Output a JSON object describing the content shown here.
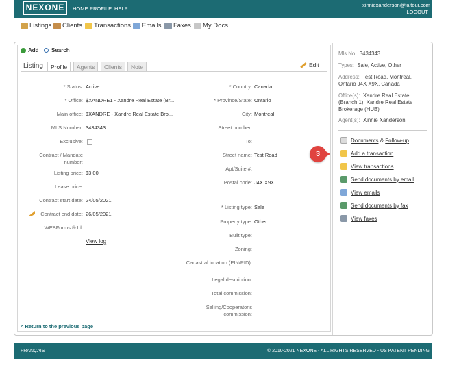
{
  "header": {
    "logo": "NEXONE",
    "nav": [
      "HOME",
      "PROFILE",
      "HELP"
    ],
    "user_email": "xinniexanderson@faltour.com",
    "logout": "LOGOUT"
  },
  "subnav": {
    "items": [
      {
        "label": "Listings",
        "icon": "house-icon"
      },
      {
        "label": "Clients",
        "icon": "people-icon"
      },
      {
        "label": "Transactions",
        "icon": "folder-icon"
      },
      {
        "label": "Emails",
        "icon": "envelope-icon"
      },
      {
        "label": "Faxes",
        "icon": "fax-icon"
      },
      {
        "label": "My Docs",
        "icon": "docs-icon"
      }
    ]
  },
  "toolbar": {
    "add": "Add",
    "search": "Search"
  },
  "tabs": {
    "title": "Listing",
    "items": [
      "Profile",
      "Agents",
      "Clients",
      "Note"
    ],
    "edit": "Edit"
  },
  "left_fields": [
    {
      "label": "* Status:",
      "value": "Active"
    },
    {
      "label": "* Office:",
      "value": "$XANDRE1 - Xandre Real Estate (Br..."
    },
    {
      "label": "Main office:",
      "value": "$XANDRE - Xandre Real Estate Bro..."
    },
    {
      "label": "MLS Number:",
      "value": "3434343"
    },
    {
      "label": "Exclusive:",
      "value": ""
    },
    {
      "label": "Contract / Mandate number:",
      "value": ""
    },
    {
      "label": "Listing price:",
      "value": "$3.00"
    },
    {
      "label": "Lease price:",
      "value": ""
    },
    {
      "label": "Contract start date:",
      "value": "24/05/2021"
    },
    {
      "label": "Contract end date:",
      "value": "26/05/2021"
    },
    {
      "label": "WEBForms ® Id:",
      "value": ""
    }
  ],
  "view_log": "View log",
  "right_fields": [
    {
      "label": "* Country:",
      "value": "Canada"
    },
    {
      "label": "* Province/State:",
      "value": "Ontario"
    },
    {
      "label": "City:",
      "value": "Montreal"
    },
    {
      "label": "Street number:",
      "value": ""
    },
    {
      "label": "To:",
      "value": ""
    },
    {
      "label": "Street name:",
      "value": "Test Road"
    },
    {
      "label": "Apt/Suite #:",
      "value": ""
    },
    {
      "label": "Postal code:",
      "value": "J4X X9X"
    },
    {
      "label": "* Listing type:",
      "value": "Sale"
    },
    {
      "label": "Property type:",
      "value": "Other"
    },
    {
      "label": "Built type:",
      "value": ""
    },
    {
      "label": "Zoning:",
      "value": ""
    },
    {
      "label": "Cadastral location (PIN/PID):",
      "value": ""
    },
    {
      "label": "Legal description:",
      "value": ""
    },
    {
      "label": "Total commission:",
      "value": ""
    },
    {
      "label": "Selling/Cooperator's commission:",
      "value": ""
    }
  ],
  "return_link": "< Return to the previous page",
  "summary": {
    "mls_label": "Mls No.",
    "mls_value": "3434343",
    "types_label": "Types:",
    "types_value": "Sale, Active, Other",
    "address_label": "Address:",
    "address_value": "Test Road, Montreal, Ontario J4X X9X, Canada",
    "offices_label": "Office(s):",
    "offices_value": "Xandre Real Estate (Branch 1), Xandre Real Estate Brokerage (HUB)",
    "agents_label": "Agent(s):",
    "agents_value": "Xinnie Xanderson"
  },
  "actions": [
    {
      "label": "Documents",
      "extra": "Follow-up",
      "icon": "document-icon"
    },
    {
      "label": "Add a transaction",
      "icon": "add-folder-icon"
    },
    {
      "label": "View transactions",
      "icon": "folder-icon"
    },
    {
      "label": "Send documents by email",
      "icon": "email-doc-icon"
    },
    {
      "label": "View emails",
      "icon": "envelope-icon"
    },
    {
      "label": "Send documents by fax",
      "icon": "fax-icon"
    },
    {
      "label": "View faxes",
      "icon": "fax-view-icon"
    }
  ],
  "callout": "3",
  "footer": {
    "language": "FRANÇAIS",
    "copyright": "© 2010-2021 NEXONE - ALL RIGHTS RESERVED - US PATENT PENDING"
  },
  "colors": {
    "brand": "#1c6b73",
    "callout": "#e0433f"
  }
}
